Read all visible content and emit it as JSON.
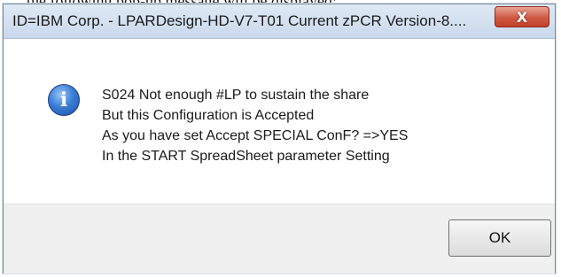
{
  "document": {
    "clipped_text": "the following pop-up message will be displayed:"
  },
  "dialog": {
    "title": "ID=IBM Corp. - LPARDesign-HD-V7-T01     Current zPCR Version-8....",
    "close_glyph": "X",
    "icon": "information-icon",
    "icon_glyph": "i",
    "message_lines": [
      "S024 Not enough #LP to sustain the share",
      "But this Configuration is Accepted",
      "As you have set Accept SPECIAL ConF? =>YES",
      "In the START SpreadSheet parameter Setting"
    ],
    "ok_label": "OK"
  },
  "colors": {
    "titlebar": "#c9d9ec",
    "close_button": "#cf5a44",
    "footer": "#f0f0f0"
  }
}
